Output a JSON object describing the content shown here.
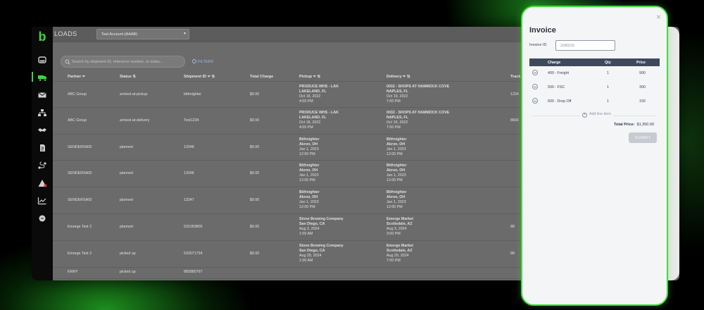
{
  "app": {
    "logo": "b",
    "title": "LOADS",
    "account_select": "Test Account (AAAB)",
    "search_placeholder": "Search by shipment ID, reference number, or notes...",
    "filters_label": "FILTERS"
  },
  "sidebar_icons": [
    "dashboard-icon",
    "truck-icon",
    "mail-icon",
    "network-icon",
    "handshake-icon",
    "document-icon",
    "route-icon",
    "alert-icon",
    "chart-icon",
    "chat-icon"
  ],
  "table": {
    "headers": {
      "partner": "Partner",
      "status": "Status",
      "shipment_id": "Shipment ID",
      "total_charge": "Total Charge",
      "pickup": "Pickup",
      "delivery": "Delivery",
      "track": "Track"
    },
    "rows": [
      {
        "partner": "ABC Group",
        "status": "arrived-at-pickup",
        "shipment_id": "bitfreighter",
        "total_charge": "$0.00",
        "pickup_name": "PRODUCE WHS - LAK",
        "pickup_city": "LAKELAND, FL",
        "pickup_date": "Oct 18, 2022",
        "pickup_time": "4:00 PM",
        "delivery_name": "0032 - SHOPS AT HAMMOCK COVE",
        "delivery_city": "NAPLES, FL",
        "delivery_date": "Oct 19, 2022",
        "delivery_time": "7:00 PM",
        "track": "1234"
      },
      {
        "partner": "ABC Group",
        "status": "arrived-at-delivery",
        "shipment_id": "Test1234",
        "total_charge": "$0.00",
        "pickup_name": "PRODUCE WHS - LAK",
        "pickup_city": "LAKELAND, FL",
        "pickup_date": "Oct 18, 2022",
        "pickup_time": "4:00 PM",
        "delivery_name": "0032 - SHOPS AT HAMMOCK COVE",
        "delivery_city": "NAPLES, FL",
        "delivery_date": "Oct 19, 2022",
        "delivery_time": "7:00 PM",
        "track": "8666"
      },
      {
        "partner": "SENDERSAID",
        "status": "planned",
        "shipment_id": "13348",
        "total_charge": "$0.00",
        "pickup_name": "Bitfreighter",
        "pickup_city": "Akron, OH",
        "pickup_date": "Jan 1, 2023",
        "pickup_time": "12:00 PM",
        "delivery_name": "Bitfreighter",
        "delivery_city": "Akron, OH",
        "delivery_date": "Jan 1, 2023",
        "delivery_time": "12:00 PM",
        "track": ""
      },
      {
        "partner": "SENDERSAID",
        "status": "planned",
        "shipment_id": "13346",
        "total_charge": "$0.00",
        "pickup_name": "Bitfreighter",
        "pickup_city": "Akron, OH",
        "pickup_date": "Jan 1, 2023",
        "pickup_time": "12:00 PM",
        "delivery_name": "Bitfreighter",
        "delivery_city": "Akron, OH",
        "delivery_date": "Jan 1, 2023",
        "delivery_time": "12:00 PM",
        "track": ""
      },
      {
        "partner": "SENDERSAID",
        "status": "planned",
        "shipment_id": "13347",
        "total_charge": "$0.00",
        "pickup_name": "Bitfreighter",
        "pickup_city": "Akron, OH",
        "pickup_date": "Jan 1, 2023",
        "pickup_time": "12:00 PM",
        "delivery_name": "Bitfreighter",
        "delivery_city": "Akron, OH",
        "delivery_date": "Jan 1, 2023",
        "delivery_time": "12:00 PM",
        "track": ""
      },
      {
        "partner": "Emerge Test 2",
        "status": "planned",
        "shipment_id": "531059805",
        "total_charge": "$0.00",
        "pickup_name": "Stone Brewing Company",
        "pickup_city": "San Diego, CA",
        "pickup_date": "Aug 3, 2024",
        "pickup_time": "1:00 AM",
        "delivery_name": "Emerge Market",
        "delivery_city": "Scottsdale, AZ",
        "delivery_date": "Aug 3, 2024",
        "delivery_time": "3:00 PM",
        "track": "88"
      },
      {
        "partner": "Emerge Test 2",
        "status": "picked up",
        "shipment_id": "533071754",
        "total_charge": "$0.00",
        "pickup_name": "Stone Brewing Company",
        "pickup_city": "San Diego, CA",
        "pickup_date": "Aug 28, 2024",
        "pickup_time": "1:00 AM",
        "delivery_name": "Emerge Market",
        "delivery_city": "Scottsdale, AZ",
        "delivery_date": "Aug 29, 2024",
        "delivery_time": "7:00 PM",
        "track": "88"
      },
      {
        "partner": "KRRY",
        "status": "picked up",
        "shipment_id": "882880797",
        "total_charge": "",
        "pickup_name": "",
        "pickup_city": "",
        "pickup_date": "",
        "pickup_time": "",
        "delivery_name": "",
        "delivery_city": "",
        "delivery_date": "",
        "delivery_time": "",
        "track": ""
      }
    ]
  },
  "invoice": {
    "close_symbol": "×",
    "title": "Invoice",
    "id_label": "Invoice ID",
    "id_value": "258315",
    "headers": {
      "charge": "Charge",
      "qty": "Qty",
      "price": "Price"
    },
    "lines": [
      {
        "charge": "400 - Freight",
        "qty": "1",
        "price": "900"
      },
      {
        "charge": "500 - FSC",
        "qty": "1",
        "price": "300"
      },
      {
        "charge": "600 - Drop Off",
        "qty": "1",
        "price": "150"
      }
    ],
    "add_line_label": "Add line item",
    "add_line_symbol": "+",
    "total_label": "Total Price:",
    "total_value": "$1,350.00",
    "submit_label": "SUBMIT"
  },
  "colors": {
    "accent": "#39d93b",
    "table_header": "#3e4a5c",
    "overlay_gray": "#6b6b6b"
  }
}
